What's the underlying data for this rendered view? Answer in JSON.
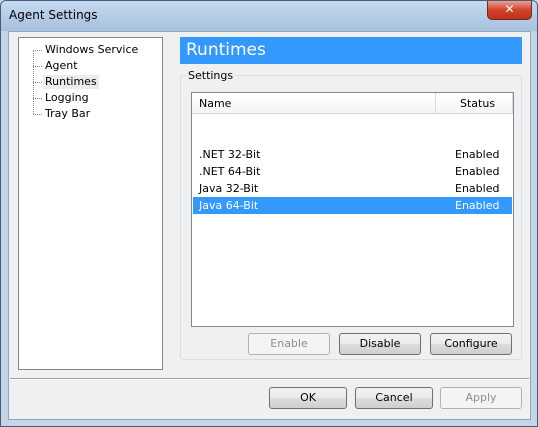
{
  "window": {
    "title": "Agent Settings",
    "close_glyph": "✕"
  },
  "tree": {
    "items": [
      {
        "label": "Windows Service",
        "selected": false
      },
      {
        "label": "Agent",
        "selected": false
      },
      {
        "label": "Runtimes",
        "selected": true
      },
      {
        "label": "Logging",
        "selected": false
      },
      {
        "label": "Tray Bar",
        "selected": false
      }
    ]
  },
  "panel": {
    "title": "Runtimes",
    "group_label": "Settings"
  },
  "list": {
    "columns": [
      "Name",
      "Status"
    ],
    "rows": [
      {
        "name": ".NET 32-Bit",
        "status": "Enabled",
        "selected": false
      },
      {
        "name": ".NET 64-Bit",
        "status": "Enabled",
        "selected": false
      },
      {
        "name": "Java 32-Bit",
        "status": "Enabled",
        "selected": false
      },
      {
        "name": "Java 64-Bit",
        "status": "Enabled",
        "selected": true
      }
    ]
  },
  "actions": {
    "enable": "Enable",
    "disable": "Disable",
    "configure": "Configure"
  },
  "footer": {
    "ok": "OK",
    "cancel": "Cancel",
    "apply": "Apply"
  },
  "colors": {
    "accent": "#3399ff",
    "close_button": "#c2301a"
  }
}
